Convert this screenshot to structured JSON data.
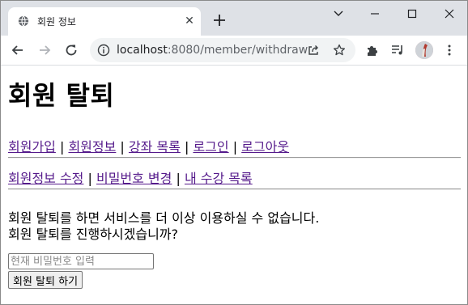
{
  "browser": {
    "tab_title": "회원 정보",
    "tab_close": "✕",
    "url_host": "localhost",
    "url_path": ":8080/member/withdraw"
  },
  "page": {
    "title": "회원 탈퇴",
    "nav_main": [
      {
        "label": "회원가입"
      },
      {
        "label": "회원정보"
      },
      {
        "label": "강좌 목록"
      },
      {
        "label": "로그인"
      },
      {
        "label": "로그아웃"
      }
    ],
    "nav_sub": [
      {
        "label": "회원정보 수정"
      },
      {
        "label": "비밀번호 변경"
      },
      {
        "label": "내 수강 목록"
      }
    ],
    "separator": " | ",
    "message_line1": "회원 탈퇴를 하면 서비스를 더 이상 이용하실 수 없습니다.",
    "message_line2": "회원 탈퇴를 진행하시겠습니까?",
    "password_placeholder": "현재 비밀번호 입력",
    "password_value": "",
    "submit_label": "회원 탈퇴 하기"
  },
  "colors": {
    "link_visited": "#551a8b",
    "tabstrip_bg": "#dee1e6",
    "omnibox_bg": "#f1f3f4"
  },
  "icons": {
    "favicon": "globe-icon",
    "new_tab": "plus-icon",
    "back": "arrow-left-icon",
    "forward": "arrow-right-icon",
    "reload": "reload-icon",
    "site_info": "info-icon",
    "share": "share-icon",
    "bookmark": "star-icon",
    "extensions": "puzzle-icon",
    "media": "media-queue-icon",
    "profile": "avatar",
    "menu": "kebab-menu-icon"
  }
}
